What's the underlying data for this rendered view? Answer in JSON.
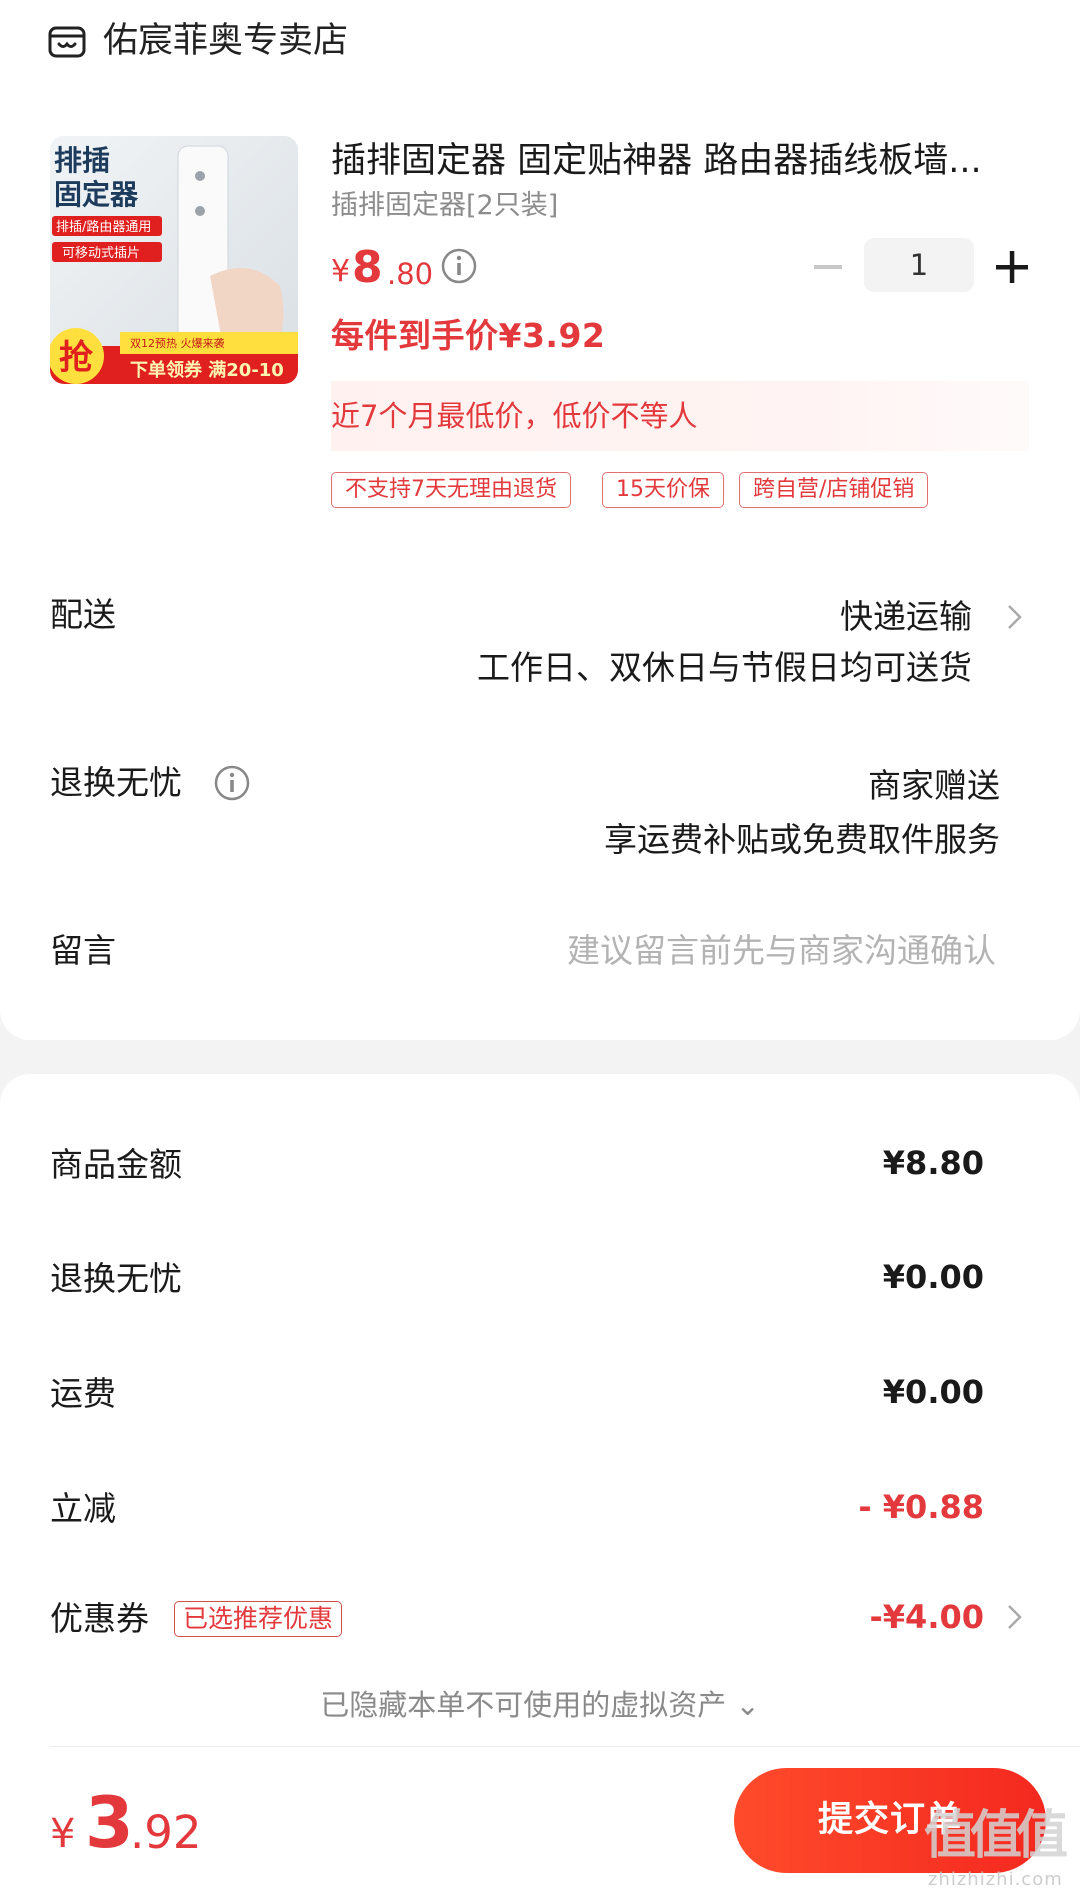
{
  "store": {
    "name": "佑宸菲奥专卖店",
    "icon": "store-icon"
  },
  "product": {
    "image_text": {
      "line1": "排插",
      "line2": "固定器",
      "badge1": "排插/路由器通用",
      "badge2": "可移动式插片",
      "grab": "抢",
      "promo_small": "双12预热 火爆来袭",
      "promo_main": "下单领券 满20-10"
    },
    "title": "插排固定器 固定贴神器 路由器插线板墙...",
    "sku": "插排固定器[2只装]",
    "price_symbol": "¥",
    "price_int": "8",
    "price_dec": ".80",
    "quantity": "1",
    "final_price_label": "每件到手价¥3.92",
    "low_price_banner": "近7个月最低价，低价不等人",
    "tags": [
      "不支持7天无理由退货",
      "15天价保",
      "跨自营/店铺促销"
    ]
  },
  "delivery": {
    "label": "配送",
    "method": "快递运输",
    "note": "工作日、双休日与节假日均可送货"
  },
  "returns": {
    "label": "退换无忧",
    "value_line1": "商家赠送",
    "value_line2": "享运费补贴或免费取件服务"
  },
  "message": {
    "label": "留言",
    "placeholder": "建议留言前先与商家沟通确认"
  },
  "summary": {
    "goods_label": "商品金额",
    "goods_value": "¥8.80",
    "returns_label": "退换无忧",
    "returns_value": "¥0.00",
    "shipping_label": "运费",
    "shipping_value": "¥0.00",
    "discount_label": "立减",
    "discount_value": "- ¥0.88",
    "coupon_label": "优惠券",
    "coupon_tag": "已选推荐优惠",
    "coupon_value": "-¥4.00",
    "hidden_note": "已隐藏本单不可使用的虚拟资产 ⌄"
  },
  "footer": {
    "total_symbol": "¥",
    "total_int": "3",
    "total_dec": ".92",
    "submit_label": "提交订单",
    "watermark": "值值值",
    "watermark_sub": "zhizhizhi.com"
  },
  "colors": {
    "accent": "#e4393c",
    "button": "#f4281f"
  }
}
